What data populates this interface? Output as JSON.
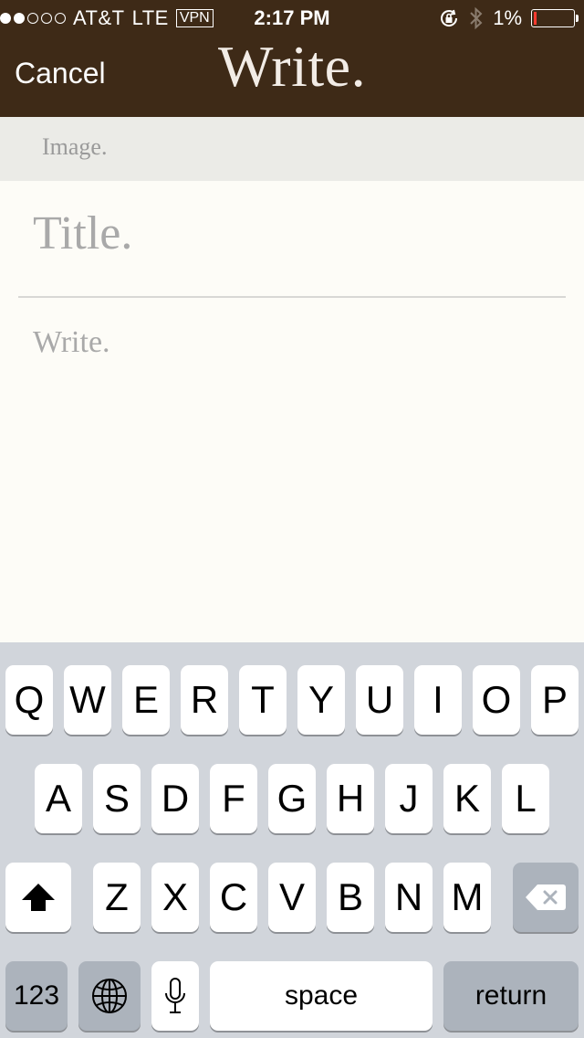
{
  "status_bar": {
    "carrier": "AT&T",
    "network": "LTE",
    "vpn": "VPN",
    "time": "2:17 PM",
    "battery": "1%",
    "battery_level": 0.01
  },
  "nav": {
    "cancel_label": "Cancel",
    "title": "Write."
  },
  "image_bar": {
    "label": "Image."
  },
  "editor": {
    "title_placeholder": "Title.",
    "body_placeholder": "Write."
  },
  "keyboard": {
    "row1": [
      "Q",
      "W",
      "E",
      "R",
      "T",
      "Y",
      "U",
      "I",
      "O",
      "P"
    ],
    "row2": [
      "A",
      "S",
      "D",
      "F",
      "G",
      "H",
      "J",
      "K",
      "L"
    ],
    "row3": [
      "Z",
      "X",
      "C",
      "V",
      "B",
      "N",
      "M"
    ],
    "numbers_label": "123",
    "space_label": "space",
    "return_label": "return"
  },
  "colors": {
    "header_bg": "#3e2a17",
    "keyboard_bg": "#d1d5db",
    "editor_bg": "#fdfcf7"
  }
}
